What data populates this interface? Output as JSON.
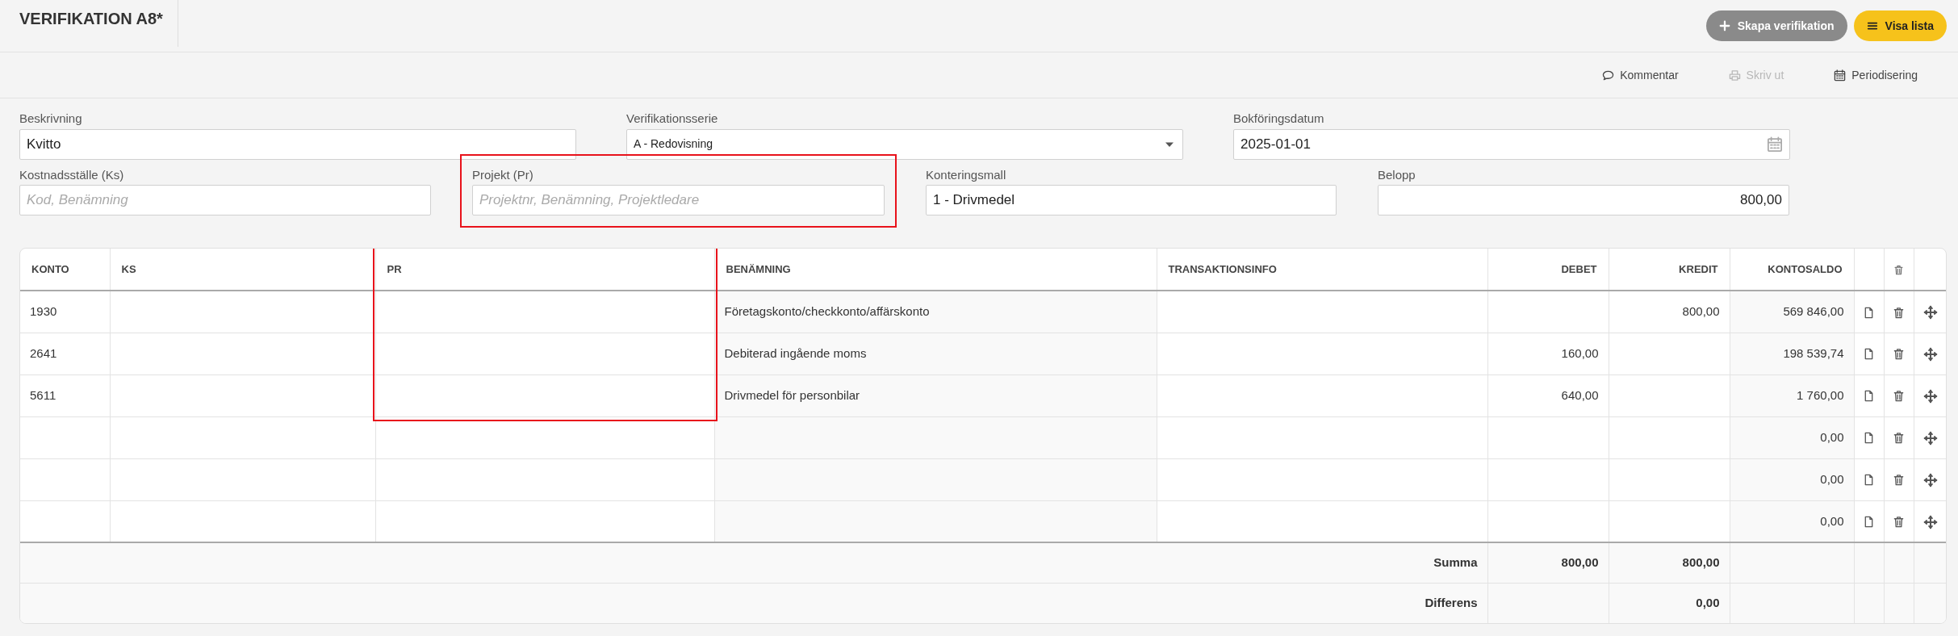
{
  "page_title": "VERIFIKATION A8*",
  "header_buttons": [
    {
      "label": "Skapa verifikation",
      "kind": "secondary"
    },
    {
      "label": "Visa lista",
      "kind": "primary"
    }
  ],
  "toolbar": [
    {
      "label": "Kommentar",
      "disabled": false
    },
    {
      "label": "Skriv ut",
      "disabled": true
    },
    {
      "label": "Periodisering",
      "disabled": false
    }
  ],
  "form_rows": [
    [
      {
        "label": "Beskrivning",
        "value": "Kvitto",
        "kind": "text",
        "highlighted": false
      },
      {
        "label": "Verifikationsserie",
        "value": "A - Redovisning",
        "kind": "select",
        "highlighted": false
      },
      {
        "label": "Bokföringsdatum",
        "value": "2025-01-01",
        "kind": "date",
        "highlighted": false
      }
    ],
    [
      {
        "label": "Kostnadsställe (Ks)",
        "placeholder": "Kod, Benämning",
        "kind": "text",
        "highlighted": false
      },
      {
        "label": "Projekt (Pr)",
        "placeholder": "Projektnr, Benämning, Projektledare",
        "kind": "text",
        "highlighted": true
      },
      {
        "label": "Konteringsmall",
        "value": "1 - Drivmedel",
        "kind": "text",
        "highlighted": false
      },
      {
        "label": "Belopp",
        "value": "800,00",
        "kind": "amount",
        "highlighted": false
      }
    ]
  ],
  "table": {
    "columns": [
      {
        "label": "KONTO",
        "highlighted": false
      },
      {
        "label": "KS",
        "highlighted": false
      },
      {
        "label": "PR",
        "highlighted": true
      },
      {
        "label": "BENÄMNING",
        "highlighted": false
      },
      {
        "label": "TRANSAKTIONSINFO",
        "highlighted": false
      },
      {
        "label": "DEBET",
        "highlighted": false
      },
      {
        "label": "KREDIT",
        "highlighted": false
      },
      {
        "label": "KONTOSALDO",
        "highlighted": false
      }
    ],
    "rows": [
      {
        "konto": "1930",
        "benamning": "Företagskonto/checkkonto/affärskonto",
        "kredit": "800,00",
        "kontosaldo": "569 846,00"
      },
      {
        "konto": "2641",
        "benamning": "Debiterad ingående moms",
        "debet": "160,00",
        "kontosaldo": "198 539,74"
      },
      {
        "konto": "5611",
        "benamning": "Drivmedel för personbilar",
        "debet": "640,00",
        "kontosaldo": "1 760,00"
      },
      {
        "kontosaldo": "0,00"
      },
      {
        "kontosaldo": "0,00"
      },
      {
        "kontosaldo": "0,00"
      }
    ],
    "footer": [
      {
        "label": "Summa",
        "debet": "800,00",
        "kredit": "800,00"
      },
      {
        "label": "Differens",
        "kredit": "0,00"
      }
    ]
  }
}
